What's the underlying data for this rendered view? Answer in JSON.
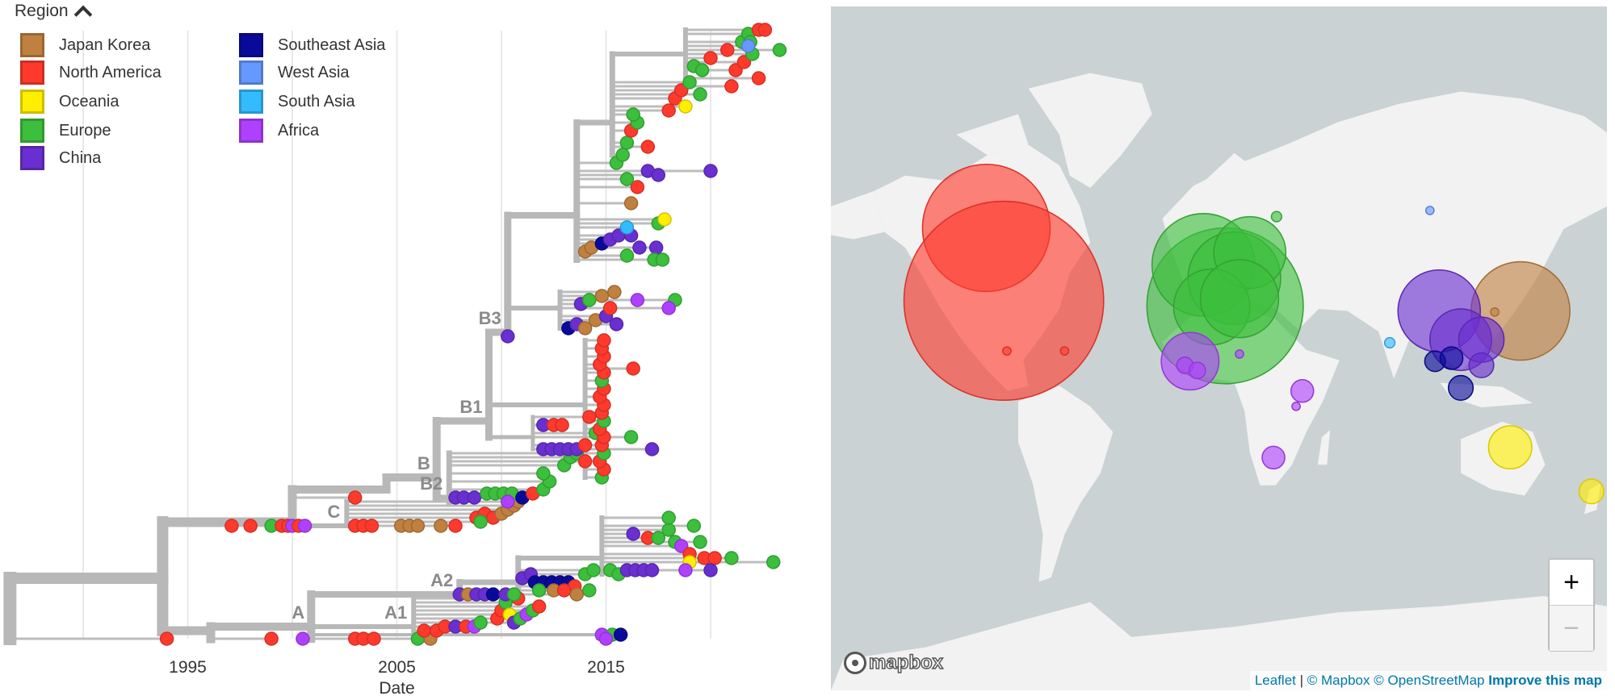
{
  "legend": {
    "title": "Region",
    "items": [
      {
        "label": "Japan Korea",
        "color": "#c08040"
      },
      {
        "label": "North America",
        "color": "#ff3a2d"
      },
      {
        "label": "Oceania",
        "color": "#ffee00"
      },
      {
        "label": "Europe",
        "color": "#3cbf3c"
      },
      {
        "label": "China",
        "color": "#6a2fd0"
      },
      {
        "label": "Southeast Asia",
        "color": "#0a0a9a"
      },
      {
        "label": "West Asia",
        "color": "#6699ff"
      },
      {
        "label": "South Asia",
        "color": "#33bbff"
      },
      {
        "label": "Africa",
        "color": "#b040ff"
      }
    ]
  },
  "map": {
    "logo": "mapbox",
    "zoom_in": "+",
    "zoom_out": "−",
    "attribution": {
      "leaflet": "Leaflet",
      "sep": "|",
      "mapbox": "© Mapbox",
      "osm": "© OpenStreetMap",
      "improve": "Improve this map"
    }
  },
  "chart_data": {
    "type": "phylogenetic-tree",
    "xlabel": "Date",
    "x_ticks": [
      "1995",
      "2005",
      "2015"
    ],
    "x_tick_values": [
      1995,
      2005,
      2015
    ],
    "grid_years": [
      1990,
      1995,
      2000,
      2005,
      2010,
      2015,
      2020
    ],
    "xlim": [
      1986.5,
      2024
    ],
    "branch_color": "#b8b8b8",
    "region_keys": {
      "jk": 0,
      "na": 1,
      "oc": 2,
      "eu": 3,
      "cn": 4,
      "sea": 5,
      "wa": 6,
      "sa": 7,
      "af": 8
    },
    "nodes": [
      {
        "id": "root",
        "parent": null,
        "date": 1986.5,
        "rank": 7,
        "label": ""
      },
      {
        "id": "n1",
        "parent": "root",
        "date": 1993.8,
        "rank": 15,
        "label": ""
      },
      {
        "id": "L",
        "parent": "n1",
        "date": 1996.1,
        "rank": 2,
        "label": ""
      },
      {
        "id": "A",
        "parent": "L",
        "date": 2000.9,
        "rank": 3,
        "label": "A"
      },
      {
        "id": "A2",
        "parent": "A",
        "date": 2008.0,
        "rank": 11,
        "label": "A2"
      },
      {
        "id": "A2b",
        "parent": "A2",
        "date": 2010.8,
        "rank": 14,
        "label": ""
      },
      {
        "id": "A2c",
        "parent": "A2b",
        "date": 2014.8,
        "rank": 20,
        "label": ""
      },
      {
        "id": "A1",
        "parent": "A",
        "date": 2005.8,
        "rank": 3,
        "label": "A1"
      },
      {
        "id": "A0",
        "parent": "A",
        "date": 2014.6,
        "rank": 1,
        "label": ""
      },
      {
        "id": "U",
        "parent": "n1",
        "date": 2000.0,
        "rank": 29,
        "label": ""
      },
      {
        "id": "C",
        "parent": "U",
        "date": 2002.6,
        "rank": 28,
        "label": "C"
      },
      {
        "id": "Bpre",
        "parent": "U",
        "date": 2004.5,
        "rank": 37,
        "label": ""
      },
      {
        "id": "B",
        "parent": "Bpre",
        "date": 2006.9,
        "rank": 40,
        "label": "B"
      },
      {
        "id": "B2",
        "parent": "B",
        "date": 2007.5,
        "rank": 35,
        "label": "B2"
      },
      {
        "id": "B1",
        "parent": "B",
        "date": 2009.4,
        "rank": 54,
        "label": "B1"
      },
      {
        "id": "B1a",
        "parent": "B1",
        "date": 2011.5,
        "rank": 50,
        "label": ""
      },
      {
        "id": "B1b",
        "parent": "B1",
        "date": 2014.0,
        "rank": 58,
        "label": ""
      },
      {
        "id": "B3",
        "parent": "B1",
        "date": 2010.3,
        "rank": 76,
        "label": "B3"
      },
      {
        "id": "B3a",
        "parent": "B3",
        "date": 2012.8,
        "rank": 82,
        "label": ""
      },
      {
        "id": "B3b",
        "parent": "B3",
        "date": 2013.6,
        "rank": 105,
        "label": ""
      },
      {
        "id": "B3c",
        "parent": "B3b",
        "date": 2015.3,
        "rank": 128,
        "label": ""
      },
      {
        "id": "B3d",
        "parent": "B3c",
        "date": 2018.8,
        "rank": 145,
        "label": ""
      }
    ],
    "tips": [
      [
        "root",
        1994.0,
        0,
        "na"
      ],
      [
        "L",
        1999.0,
        0,
        "na"
      ],
      [
        "A",
        2000.5,
        0,
        "af"
      ],
      [
        "A",
        2003.0,
        0,
        "na"
      ],
      [
        "A",
        2003.4,
        0,
        "na"
      ],
      [
        "A",
        2003.9,
        0,
        "na"
      ],
      [
        "A",
        2006.0,
        0,
        "eu"
      ],
      [
        "A",
        2006.6,
        0,
        "jk"
      ],
      [
        "A0",
        2014.8,
        1,
        "af"
      ],
      [
        "A0",
        2015.3,
        1,
        "eu"
      ],
      [
        "A0",
        2015.7,
        1,
        "sea"
      ],
      [
        "A0",
        2015.0,
        0,
        "af"
      ],
      [
        "A1",
        2006.3,
        2,
        "na"
      ],
      [
        "A1",
        2006.9,
        2,
        "na"
      ],
      [
        "A1",
        2007.3,
        3,
        "na"
      ],
      [
        "A1",
        2007.8,
        3,
        "cn"
      ],
      [
        "A1",
        2008.3,
        3,
        "na"
      ],
      [
        "A1",
        2008.7,
        3,
        "af"
      ],
      [
        "A1",
        2009.0,
        4,
        "eu"
      ],
      [
        "A1",
        2009.8,
        5,
        "na"
      ],
      [
        "A1",
        2010.0,
        7,
        "na"
      ],
      [
        "A1",
        2010.2,
        9,
        "eu"
      ],
      [
        "A1",
        2010.4,
        6,
        "oc"
      ],
      [
        "A1",
        2010.6,
        4,
        "cn"
      ],
      [
        "A1",
        2010.9,
        5,
        "eu"
      ],
      [
        "A1",
        2011.2,
        6,
        "af"
      ],
      [
        "A1",
        2011.5,
        7,
        "eu"
      ],
      [
        "A1",
        2011.8,
        8,
        "na"
      ],
      [
        "A1",
        2010.8,
        10,
        "na"
      ],
      [
        "A2",
        2008.0,
        11,
        "cn"
      ],
      [
        "A2",
        2008.4,
        11,
        "jk"
      ],
      [
        "A2",
        2008.8,
        11,
        "cn"
      ],
      [
        "A2",
        2009.2,
        11,
        "cn"
      ],
      [
        "A2",
        2009.6,
        11,
        "sea"
      ],
      [
        "A2",
        2010.2,
        11,
        "cn"
      ],
      [
        "A2",
        2010.6,
        11,
        "eu"
      ],
      [
        "A2b",
        2011.0,
        15,
        "cn"
      ],
      [
        "A2b",
        2011.4,
        16,
        "cn"
      ],
      [
        "A2b",
        2011.6,
        14,
        "sea"
      ],
      [
        "A2b",
        2012.0,
        14,
        "sea"
      ],
      [
        "A2b",
        2012.4,
        14,
        "sea"
      ],
      [
        "A2b",
        2012.8,
        14,
        "sea"
      ],
      [
        "A2b",
        2013.2,
        14,
        "sea"
      ],
      [
        "A2b",
        2013.5,
        13,
        "na"
      ],
      [
        "A2b",
        2012.5,
        12,
        "jk"
      ],
      [
        "A2b",
        2013.0,
        12,
        "na"
      ],
      [
        "A2b",
        2011.8,
        12,
        "eu"
      ],
      [
        "A2b",
        2014.0,
        16,
        "eu"
      ],
      [
        "A2b",
        2014.4,
        17,
        "eu"
      ],
      [
        "A2b",
        2014.2,
        12,
        "eu"
      ],
      [
        "A2b",
        2013.6,
        11,
        "jk"
      ],
      [
        "A2c",
        2015.2,
        17,
        "eu"
      ],
      [
        "A2c",
        2015.6,
        16,
        "eu"
      ],
      [
        "A2c",
        2016.0,
        17,
        "cn"
      ],
      [
        "A2c",
        2016.4,
        17,
        "cn"
      ],
      [
        "A2c",
        2016.8,
        17,
        "cn"
      ],
      [
        "A2c",
        2017.2,
        17,
        "cn"
      ],
      [
        "A2c",
        2016.3,
        26,
        "cn"
      ],
      [
        "A2c",
        2017.0,
        25,
        "na"
      ],
      [
        "A2c",
        2017.5,
        25,
        "eu"
      ],
      [
        "A2c",
        2018.0,
        27,
        "eu"
      ],
      [
        "A2c",
        2018.0,
        30,
        "eu"
      ],
      [
        "A2c",
        2018.3,
        24,
        "eu"
      ],
      [
        "A2c",
        2018.6,
        23,
        "af"
      ],
      [
        "A2c",
        2019.2,
        28,
        "eu"
      ],
      [
        "A2c",
        2019.5,
        24,
        "eu"
      ],
      [
        "A2c",
        2019.0,
        21,
        "na"
      ],
      [
        "A2c",
        2019.7,
        20,
        "na"
      ],
      [
        "A2c",
        2020.2,
        20,
        "na"
      ],
      [
        "A2c",
        2019.0,
        19,
        "oc"
      ],
      [
        "A2c",
        2018.8,
        17,
        "af"
      ],
      [
        "A2c",
        2021.0,
        20,
        "eu"
      ],
      [
        "A2c",
        2023.0,
        19,
        "eu"
      ],
      [
        "A2c",
        2020.0,
        17,
        "cn"
      ],
      [
        "n1",
        1997.1,
        28,
        "na"
      ],
      [
        "n1",
        1998.0,
        28,
        "na"
      ],
      [
        "n1",
        1999.0,
        28,
        "eu"
      ],
      [
        "n1",
        1999.5,
        28,
        "na"
      ],
      [
        "n1",
        1999.8,
        28,
        "na"
      ],
      [
        "n1",
        2000.0,
        28,
        "af"
      ],
      [
        "n1",
        2000.3,
        28,
        "na"
      ],
      [
        "n1",
        2000.6,
        28,
        "af"
      ],
      [
        "C",
        2003.0,
        28,
        "na"
      ],
      [
        "C",
        2003.4,
        28,
        "na"
      ],
      [
        "C",
        2003.8,
        28,
        "na"
      ],
      [
        "C",
        2005.2,
        28,
        "jk"
      ],
      [
        "C",
        2005.6,
        28,
        "jk"
      ],
      [
        "C",
        2006.0,
        28,
        "jk"
      ],
      [
        "C",
        2007.1,
        28,
        "jk"
      ],
      [
        "C",
        2007.8,
        28,
        "na"
      ],
      [
        "C",
        2008.8,
        30,
        "na"
      ],
      [
        "C",
        2009.2,
        31,
        "na"
      ],
      [
        "C",
        2009.6,
        30,
        "na"
      ],
      [
        "C",
        2010.0,
        31,
        "jk"
      ],
      [
        "C",
        2010.3,
        32,
        "jk"
      ],
      [
        "C",
        2010.6,
        33,
        "jk"
      ],
      [
        "C",
        2009.0,
        29,
        "eu"
      ],
      [
        "C",
        2010.8,
        34,
        "jk"
      ],
      [
        "U",
        2003.0,
        35,
        "na"
      ],
      [
        "B2",
        2007.8,
        35,
        "cn"
      ],
      [
        "B2",
        2008.2,
        35,
        "cn"
      ],
      [
        "B2",
        2008.7,
        35,
        "cn"
      ],
      [
        "B2",
        2009.3,
        36,
        "eu"
      ],
      [
        "B2",
        2009.7,
        36,
        "eu"
      ],
      [
        "B2",
        2010.1,
        36,
        "eu"
      ],
      [
        "B2",
        2010.5,
        36,
        "eu"
      ],
      [
        "B2",
        2011.0,
        35,
        "sea"
      ],
      [
        "B2",
        2010.3,
        34,
        "af"
      ],
      [
        "B2",
        2011.5,
        36,
        "na"
      ],
      [
        "B2",
        2012.0,
        37,
        "eu"
      ],
      [
        "B2",
        2012.3,
        39,
        "eu"
      ],
      [
        "B2",
        2012.0,
        41,
        "eu"
      ],
      [
        "B2",
        2013.0,
        43,
        "eu"
      ],
      [
        "B2",
        2013.3,
        45,
        "eu"
      ],
      [
        "B2",
        2013.6,
        46,
        "eu"
      ],
      [
        "B2",
        2014.0,
        44,
        "na"
      ],
      [
        "B1a",
        2012.0,
        47,
        "cn"
      ],
      [
        "B1a",
        2012.4,
        47,
        "cn"
      ],
      [
        "B1a",
        2012.8,
        47,
        "cn"
      ],
      [
        "B1a",
        2013.2,
        47,
        "cn"
      ],
      [
        "B1a",
        2013.6,
        47,
        "cn"
      ],
      [
        "B1a",
        2014.0,
        48,
        "na"
      ],
      [
        "B1a",
        2017.2,
        47,
        "cn"
      ],
      [
        "B1a",
        2014.5,
        51,
        "eu"
      ],
      [
        "B1a",
        2016.2,
        50,
        "eu"
      ],
      [
        "B1a",
        2012.0,
        53,
        "cn"
      ],
      [
        "B1a",
        2012.5,
        53,
        "na"
      ],
      [
        "B1a",
        2012.9,
        53,
        "na"
      ],
      [
        "B1a",
        2014.2,
        55,
        "na"
      ],
      [
        "B1b",
        2014.8,
        40,
        "eu"
      ],
      [
        "B1b",
        2014.9,
        42,
        "na"
      ],
      [
        "B1b",
        2014.7,
        44,
        "na"
      ],
      [
        "B1b",
        2014.9,
        46,
        "eu"
      ],
      [
        "B1b",
        2014.8,
        48,
        "na"
      ],
      [
        "B1b",
        2014.9,
        50,
        "na"
      ],
      [
        "B1b",
        2014.7,
        52,
        "na"
      ],
      [
        "B1b",
        2014.9,
        54,
        "eu"
      ],
      [
        "B1b",
        2014.8,
        56,
        "na"
      ],
      [
        "B1b",
        2014.9,
        58,
        "na"
      ],
      [
        "B1b",
        2014.7,
        60,
        "na"
      ],
      [
        "B1b",
        2014.9,
        62,
        "na"
      ],
      [
        "B1b",
        2014.8,
        64,
        "eu"
      ],
      [
        "B1b",
        2014.9,
        66,
        "na"
      ],
      [
        "B1b",
        2014.7,
        68,
        "na"
      ],
      [
        "B1b",
        2014.9,
        70,
        "na"
      ],
      [
        "B1b",
        2014.8,
        72,
        "na"
      ],
      [
        "B1b",
        2014.9,
        74,
        "na"
      ],
      [
        "B1b",
        2016.3,
        67,
        "na"
      ],
      [
        "B3",
        2010.3,
        75,
        "cn"
      ],
      [
        "B3a",
        2013.2,
        77,
        "sea"
      ],
      [
        "B3a",
        2013.6,
        78,
        "cn"
      ],
      [
        "B3a",
        2014.0,
        77,
        "jk"
      ],
      [
        "B3a",
        2014.5,
        79,
        "jk"
      ],
      [
        "B3a",
        2015.0,
        80,
        "cn"
      ],
      [
        "B3a",
        2015.5,
        78,
        "cn"
      ],
      [
        "B3a",
        2013.8,
        83,
        "cn"
      ],
      [
        "B3a",
        2014.2,
        84,
        "eu"
      ],
      [
        "B3a",
        2014.8,
        85,
        "jk"
      ],
      [
        "B3a",
        2015.4,
        86,
        "jk"
      ],
      [
        "B3a",
        2016.5,
        84,
        "af"
      ],
      [
        "B3a",
        2018.3,
        84,
        "eu"
      ],
      [
        "B3a",
        2018.0,
        82,
        "af"
      ],
      [
        "B3a",
        2015.2,
        82,
        "na"
      ],
      [
        "B3b",
        2014.0,
        96,
        "jk"
      ],
      [
        "B3b",
        2014.3,
        97,
        "jk"
      ],
      [
        "B3b",
        2014.8,
        98,
        "sea"
      ],
      [
        "B3b",
        2015.2,
        99,
        "cn"
      ],
      [
        "B3b",
        2015.6,
        100,
        "cn"
      ],
      [
        "B3b",
        2016.2,
        100,
        "cn"
      ],
      [
        "B3b",
        2016.6,
        97,
        "cn"
      ],
      [
        "B3b",
        2017.4,
        97,
        "cn"
      ],
      [
        "B3b",
        2016.0,
        95,
        "eu"
      ],
      [
        "B3b",
        2017.3,
        94,
        "eu"
      ],
      [
        "B3b",
        2017.7,
        94,
        "eu"
      ],
      [
        "B3b",
        2016.0,
        102,
        "sa"
      ],
      [
        "B3b",
        2017.5,
        103,
        "eu"
      ],
      [
        "B3b",
        2017.8,
        104,
        "oc"
      ],
      [
        "B3b",
        2016.2,
        108,
        "jk"
      ],
      [
        "B3b",
        2016.5,
        112,
        "na"
      ],
      [
        "B3b",
        2016.0,
        114,
        "eu"
      ],
      [
        "B3b",
        2017.0,
        116,
        "cn"
      ],
      [
        "B3b",
        2017.5,
        115,
        "cn"
      ],
      [
        "B3b",
        2020.0,
        116,
        "cn"
      ],
      [
        "B3b",
        2015.5,
        118,
        "eu"
      ],
      [
        "B3c",
        2015.8,
        120,
        "eu"
      ],
      [
        "B3c",
        2016.0,
        123,
        "eu"
      ],
      [
        "B3c",
        2016.2,
        126,
        "na"
      ],
      [
        "B3c",
        2016.5,
        128,
        "eu"
      ],
      [
        "B3c",
        2016.3,
        130,
        "eu"
      ],
      [
        "B3c",
        2017.0,
        122,
        "na"
      ],
      [
        "B3c",
        2018.0,
        131,
        "na"
      ],
      [
        "B3c",
        2018.3,
        134,
        "na"
      ],
      [
        "B3c",
        2018.8,
        132,
        "oc"
      ],
      [
        "B3c",
        2018.6,
        136,
        "na"
      ],
      [
        "B3c",
        2019.0,
        138,
        "eu"
      ],
      [
        "B3c",
        2019.5,
        135,
        "eu"
      ],
      [
        "B3c",
        2021.0,
        137,
        "na"
      ],
      [
        "B3d",
        2019.2,
        142,
        "eu"
      ],
      [
        "B3d",
        2019.6,
        141,
        "eu"
      ],
      [
        "B3d",
        2020.0,
        144,
        "na"
      ],
      [
        "B3d",
        2020.8,
        146,
        "na"
      ],
      [
        "B3d",
        2021.2,
        141,
        "na"
      ],
      [
        "B3d",
        2021.6,
        143,
        "na"
      ],
      [
        "B3d",
        2022.0,
        145,
        "eu"
      ],
      [
        "B3d",
        2022.3,
        139,
        "na"
      ],
      [
        "B3d",
        2021.5,
        148,
        "eu"
      ],
      [
        "B3d",
        2021.8,
        150,
        "eu"
      ],
      [
        "B3d",
        2022.3,
        151,
        "na"
      ],
      [
        "B3d",
        2022.6,
        151,
        "na"
      ],
      [
        "B3d",
        2021.9,
        148,
        "eu"
      ],
      [
        "B3d",
        2021.8,
        147,
        "wa"
      ],
      [
        "B3d",
        2023.3,
        146,
        "eu"
      ]
    ]
  }
}
